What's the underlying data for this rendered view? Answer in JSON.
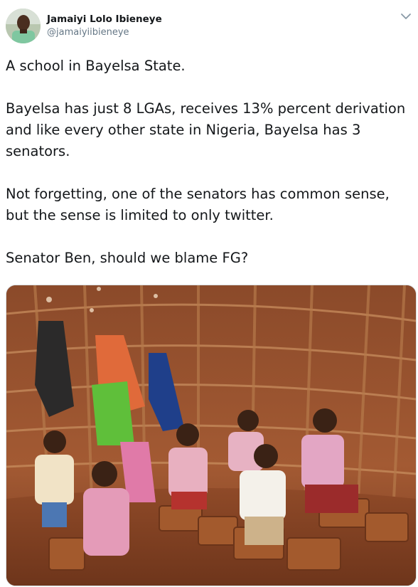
{
  "tweet": {
    "author": {
      "display_name": "Jamaiyi Lolo Ibieneye",
      "handle": "@jamaiyiibieneye",
      "avatar_icon": "user-avatar"
    },
    "menu_icon": "chevron-down-icon",
    "paragraphs": [
      "A school in Bayelsa State.",
      "Bayelsa has just 8 LGAs, receives 13% percent derivation and like every other state in Nigeria, Bayelsa has 3 senators.",
      "Not forgetting, one of the senators has common sense, but the sense is limited to only twitter.",
      "Senator Ben, should we blame FG?"
    ],
    "media": {
      "type": "photo"
    }
  },
  "colors": {
    "text": "#14171a",
    "secondary_text": "#657786",
    "border": "#d9dee2"
  }
}
